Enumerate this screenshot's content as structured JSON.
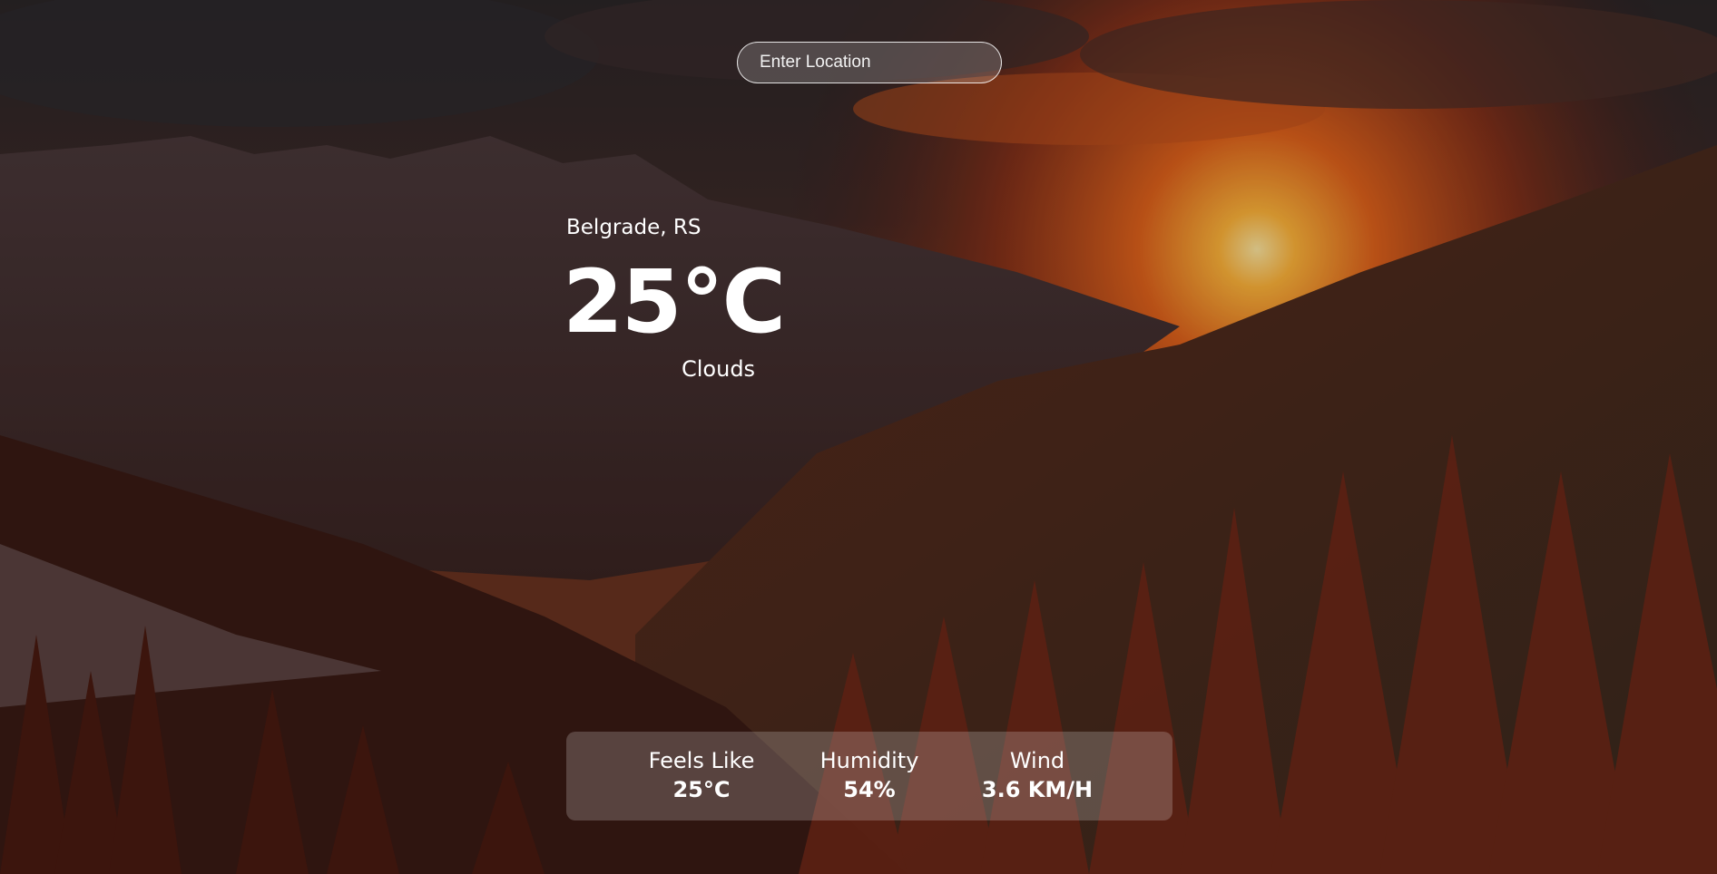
{
  "search": {
    "placeholder": "Enter Location",
    "value": ""
  },
  "weather": {
    "location": "Belgrade, RS",
    "temperature": "25°C",
    "description": "Clouds"
  },
  "stats": [
    {
      "label": "Feels Like",
      "value": "25°C"
    },
    {
      "label": "Humidity",
      "value": "54%"
    },
    {
      "label": "Wind",
      "value": "3.6 KM/H"
    }
  ],
  "colors": {
    "text": "#ffffff",
    "panel": "rgba(255,255,255,0.2)",
    "sun": "#ffb347"
  },
  "background": {
    "scene": "mountain sunset with pine forest"
  }
}
